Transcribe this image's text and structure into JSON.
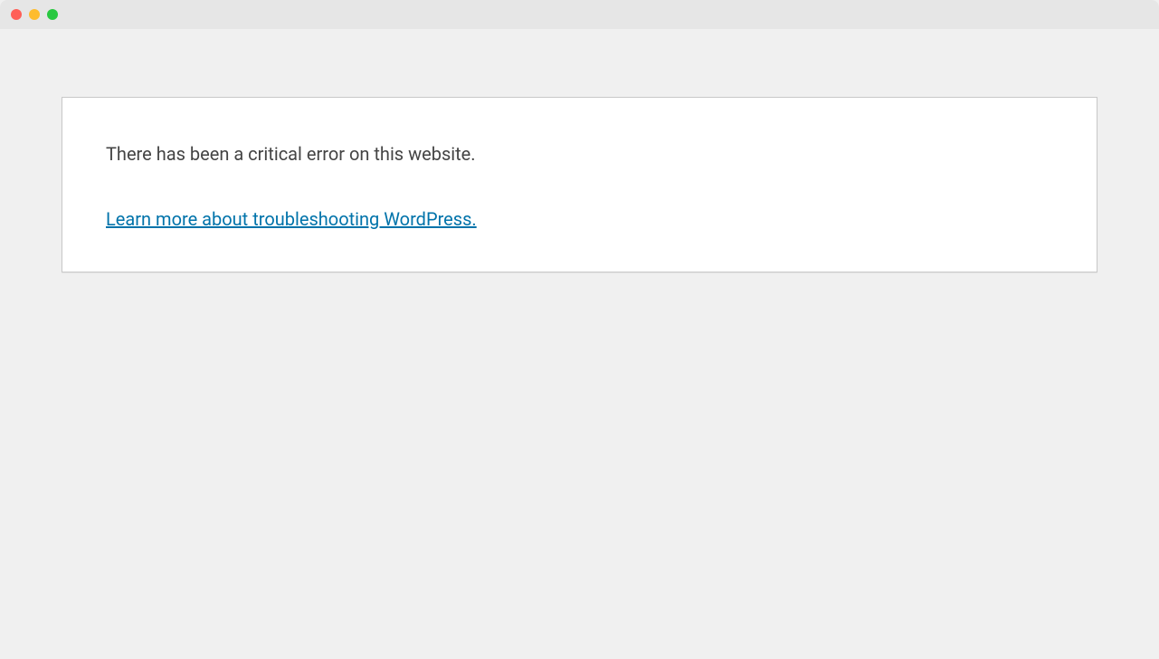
{
  "error": {
    "message": "There has been a critical error on this website.",
    "link_text": "Learn more about troubleshooting WordPress."
  }
}
